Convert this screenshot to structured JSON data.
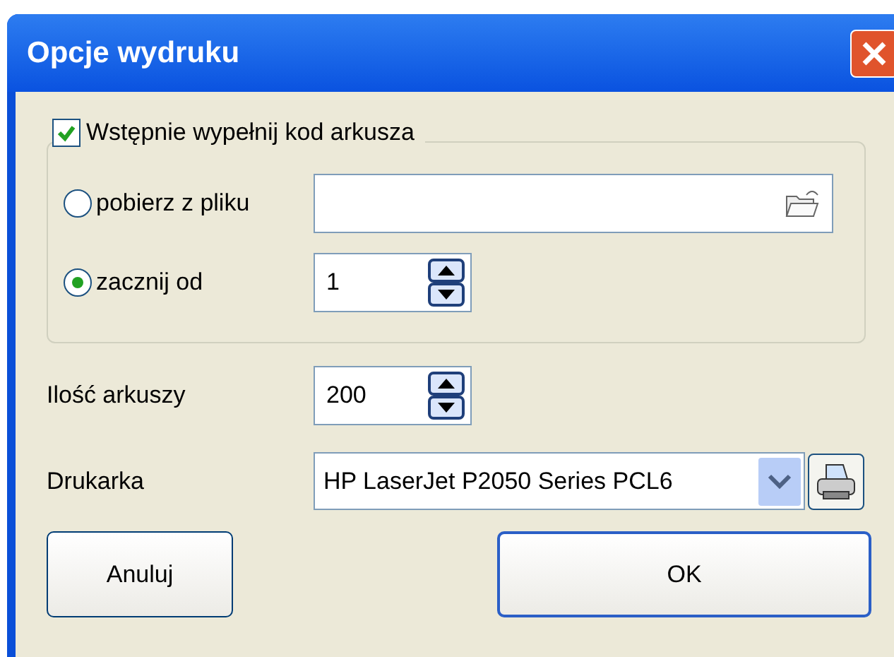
{
  "window": {
    "title": "Opcje wydruku"
  },
  "prefill": {
    "label": "Wstępnie wypełnij kod arkusza",
    "checked": true
  },
  "sources": [
    {
      "kind": "file",
      "label": "pobierz z pliku",
      "selected": false
    },
    {
      "kind": "spin",
      "label": "zacznij od",
      "selected": true,
      "value": "1"
    }
  ],
  "sheet_count": {
    "label": "Ilość arkuszy",
    "value": "200"
  },
  "printer": {
    "label": "Drukarka",
    "value": "HP LaserJet P2050 Series PCL6"
  },
  "buttons": [
    {
      "label": "Anuluj",
      "default": false
    },
    {
      "label": "OK",
      "default": true
    }
  ]
}
